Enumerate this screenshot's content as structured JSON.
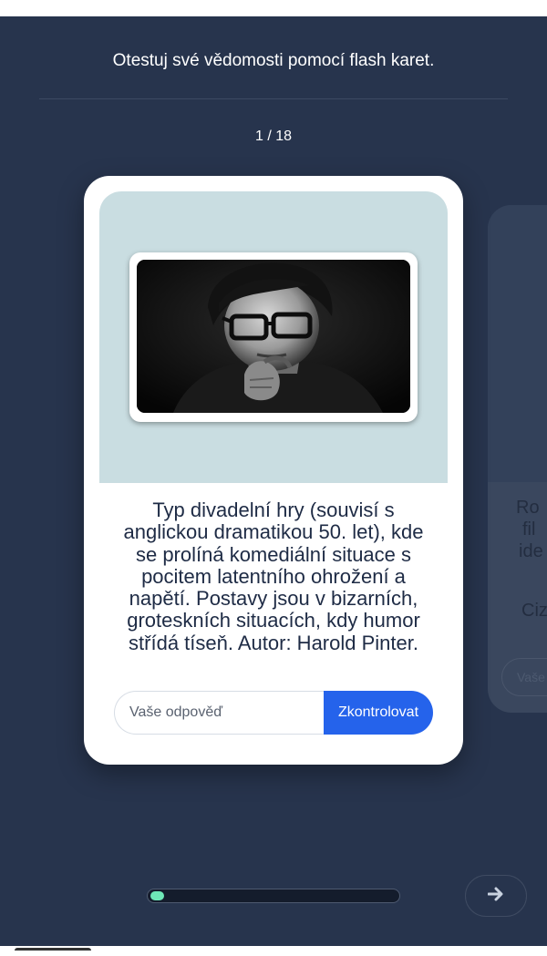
{
  "intro": "Otestuj své vědomosti pomocí flash karet.",
  "counter": "1 / 18",
  "card": {
    "image_alt": "Harold Pinter portrait photo",
    "question": "Typ divadelní hry (souvisí s anglickou dramatikou 50. let), kde se prolíná komediální situace s pocitem latentního ohrožení a napětí. Postavy jsou v bizarních, groteskních situacích, kdy humor střídá tíseň. Autor: Harold Pinter.",
    "answer_placeholder": "Vaše odpověď",
    "answer_value": "",
    "check_label": "Zkontrolovat"
  },
  "next_card": {
    "text_lines": [
      "Ro",
      "fil",
      "ide"
    ],
    "hint": "Ciz",
    "input_placeholder": "Vaše"
  },
  "progress": {
    "current": 1,
    "total": 18
  },
  "icons": {
    "next": "arrow-right-icon"
  },
  "colors": {
    "background": "#27344d",
    "card": "#ffffff",
    "image_area": "#c9dde1",
    "primary_button": "#2563eb",
    "progress_fill": "#6ee7b7"
  }
}
